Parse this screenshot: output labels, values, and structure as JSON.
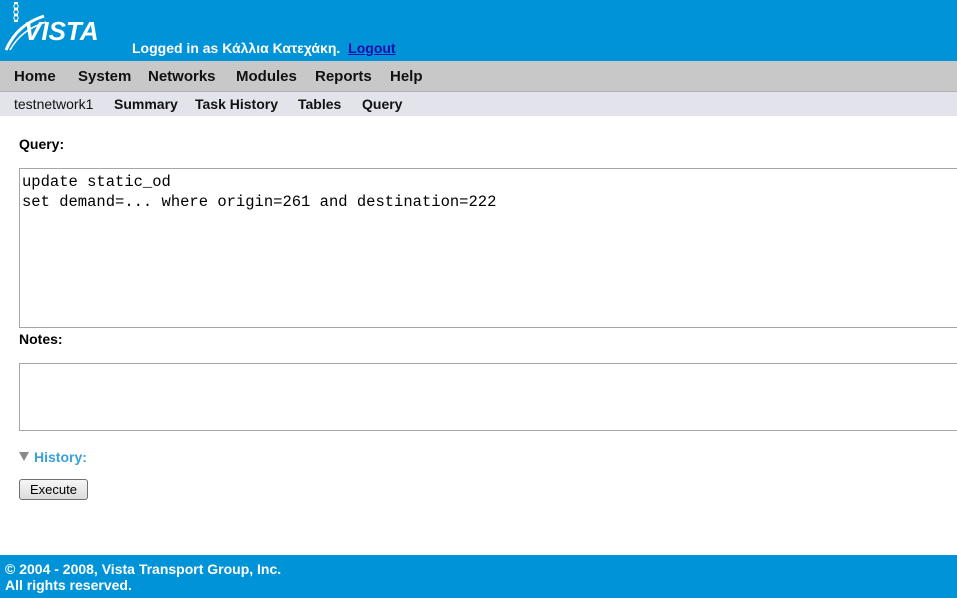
{
  "header": {
    "logo_text": "VISTA",
    "login_text": "Logged in as Κάλλια Κατεχάκη.",
    "logout_label": "Logout",
    "background_color": "#0193d7"
  },
  "main_nav": [
    "Home",
    "System",
    "Networks",
    "Modules",
    "Reports",
    "Help"
  ],
  "sub_nav": {
    "network_name": "testnetwork1",
    "items": [
      "Summary",
      "Task History",
      "Tables",
      "Query"
    ]
  },
  "form": {
    "query_label": "Query:",
    "query_value": "update static_od\nset demand=... where origin=261 and destination=222",
    "notes_label": "Notes:",
    "notes_value": "",
    "history_label": "History:",
    "execute_label": "Execute"
  },
  "footer": {
    "line1": "© 2004 - 2008, Vista Transport Group, Inc.",
    "line2": "All rights reserved."
  }
}
